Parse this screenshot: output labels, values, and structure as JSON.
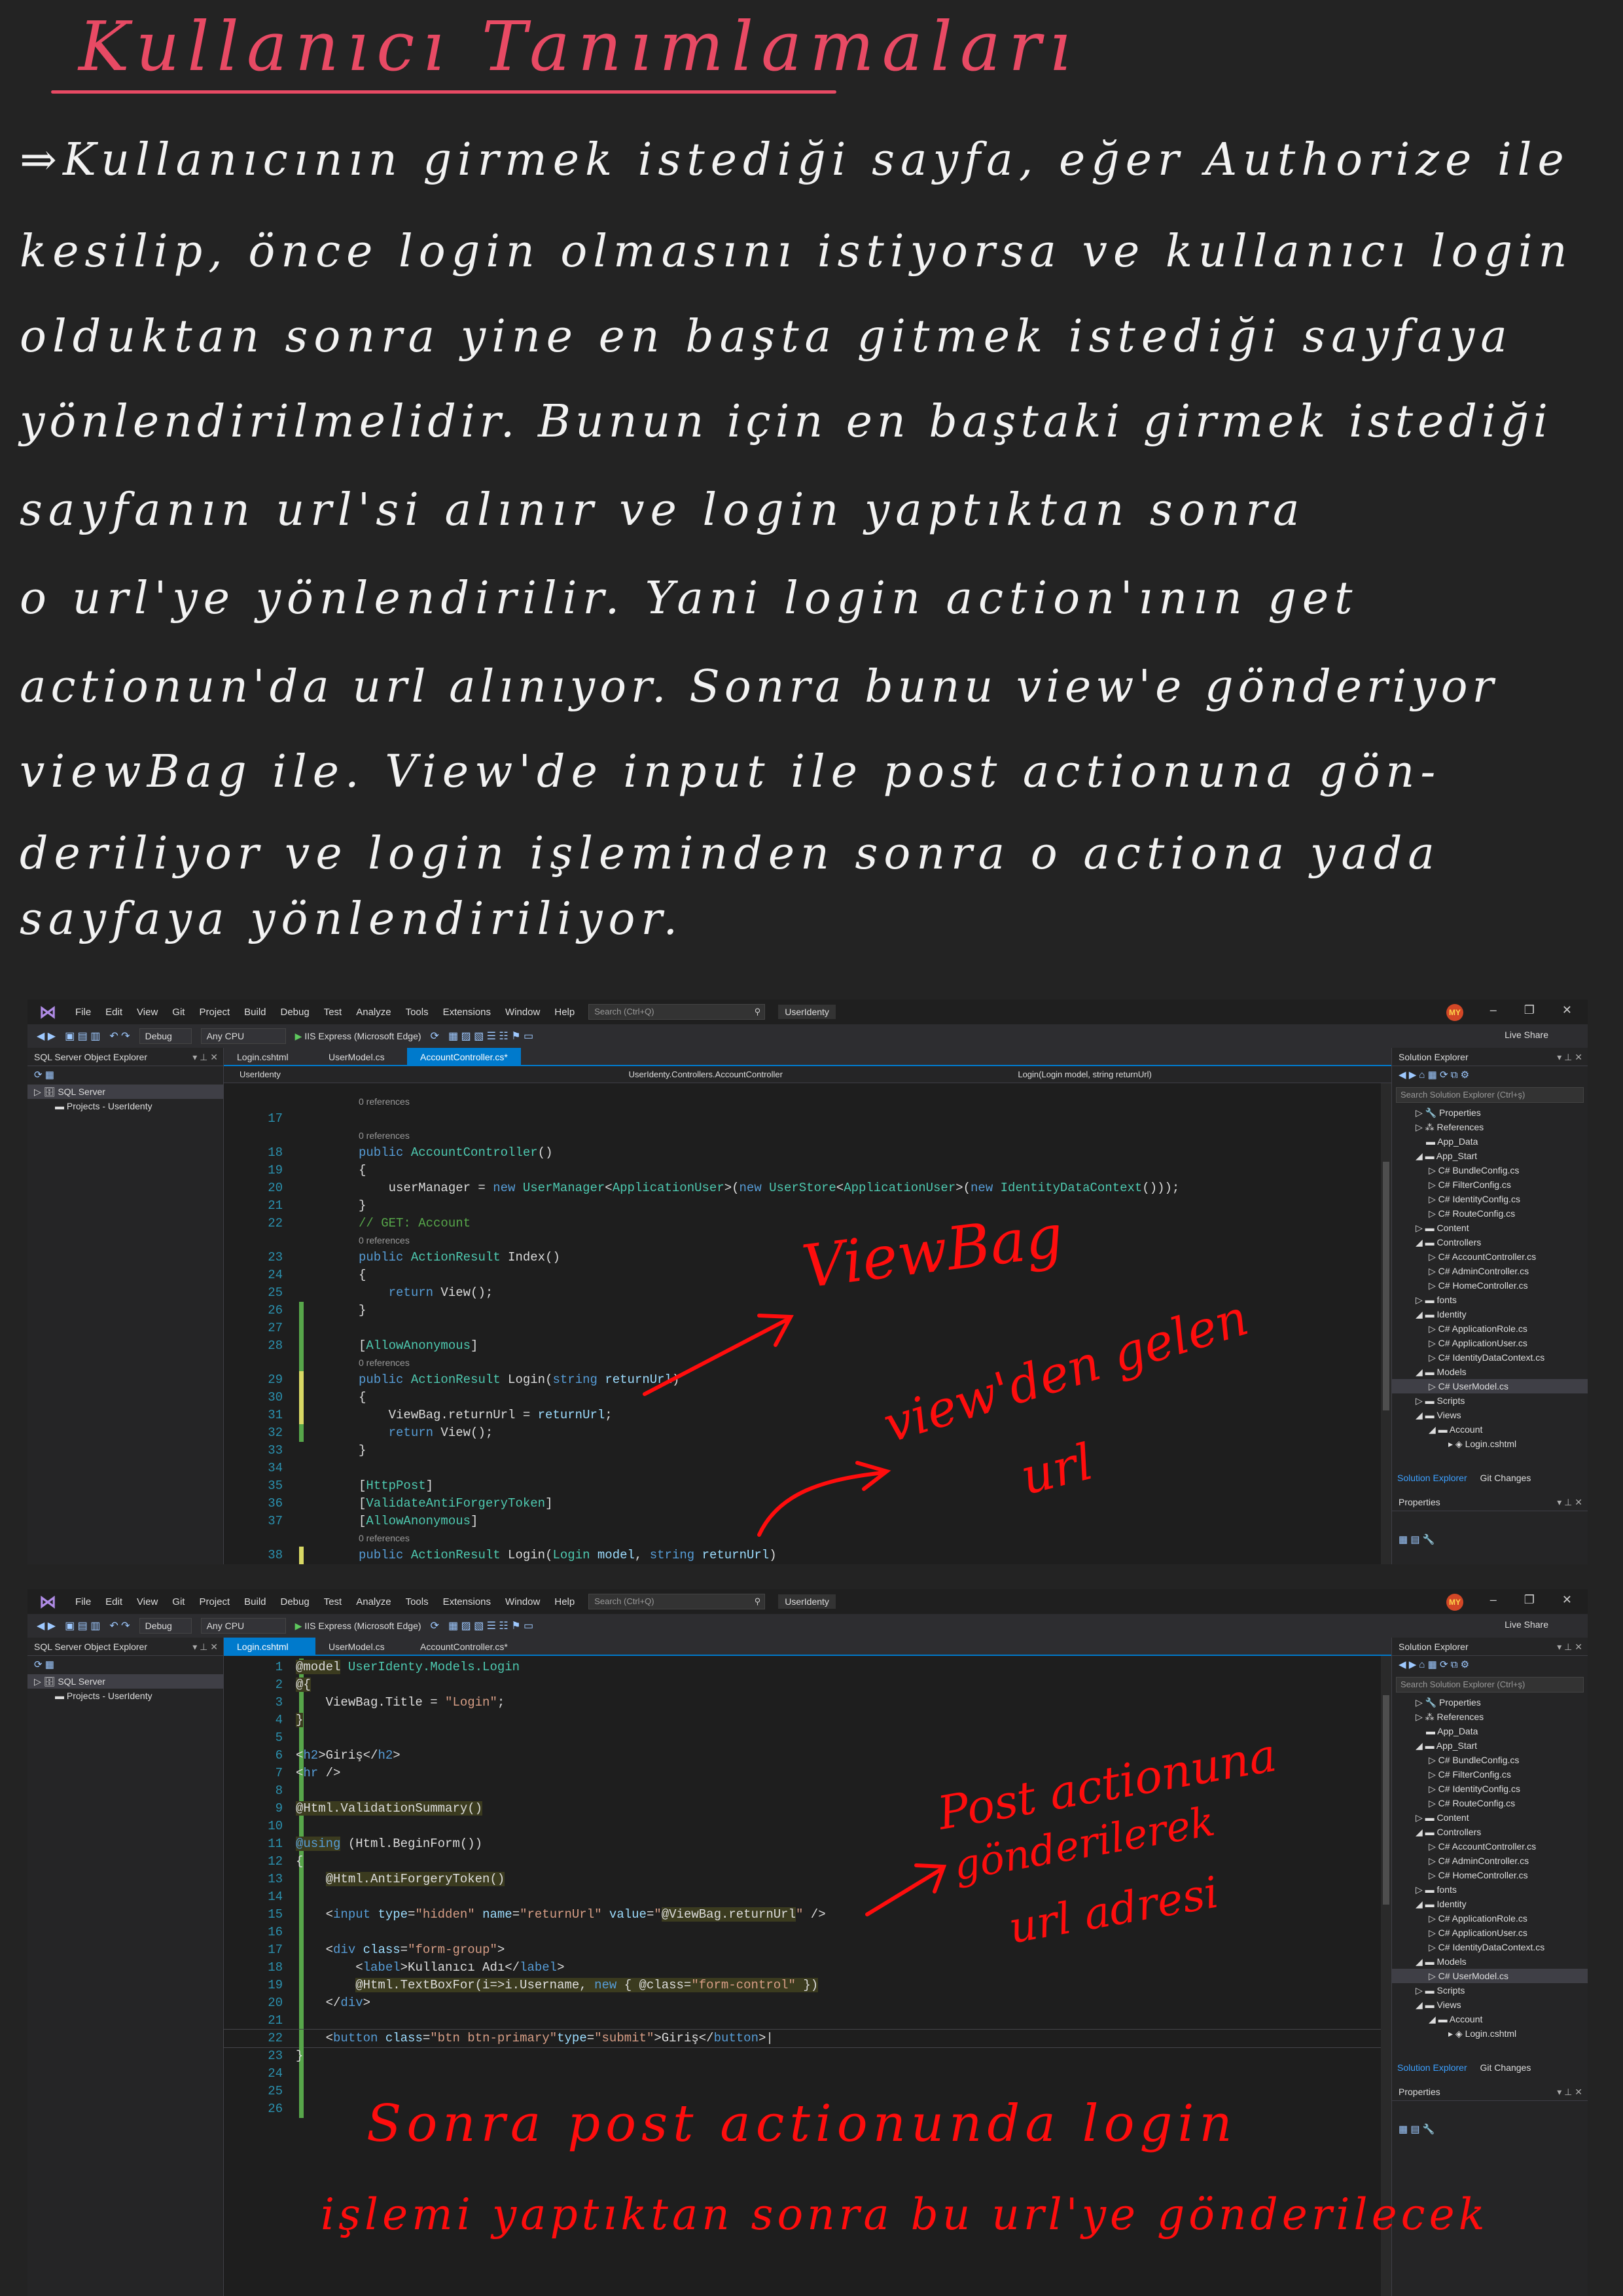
{
  "notes": {
    "title": "Kullanıcı Tanımlamaları",
    "lines": [
      "⇒Kullanıcının girmek istediği sayfa, eğer Authorize ile",
      "kesilip, önce login olmasını istiyorsa ve kullanıcı login",
      "olduktan sonra yine en başta gitmek istediği sayfaya",
      "yönlendirilmelidir. Bunun için en baştaki girmek istediği",
      "sayfanın url'si alınır ve login yaptıktan sonra",
      "o url'ye yönlendirilir. Yani login action'ının get",
      "actionun'da url alınıyor. Sonra bunu view'e gönderiyor",
      "viewBag ile. View'de input ile post actionuna gön-",
      "deriliyor ve login işleminden sonra o actiona yada",
      "sayfaya yönlendiriliyor."
    ]
  },
  "ide": {
    "menu": [
      "File",
      "Edit",
      "View",
      "Git",
      "Project",
      "Build",
      "Debug",
      "Test",
      "Analyze",
      "Tools",
      "Extensions",
      "Window",
      "Help"
    ],
    "search_placeholder": "Search (Ctrl+Q)",
    "project": "UserIdenty",
    "avatar": "MY",
    "config": "Debug",
    "platform": "Any CPU",
    "run_target": "IIS Express (Microsoft Edge)",
    "live_share": "Live Share",
    "left_panel_title": "SQL Server Object Explorer",
    "left_tree": [
      "SQL Server",
      "Projects - UserIdenty"
    ],
    "right_panel_title": "Solution Explorer",
    "right_search": "Search Solution Explorer (Ctrl+ş)",
    "solution_tree": [
      "Properties",
      "References",
      "App_Data",
      "App_Start",
      "BundleConfig.cs",
      "FilterConfig.cs",
      "IdentityConfig.cs",
      "RouteConfig.cs",
      "Content",
      "Controllers",
      "AccountController.cs",
      "AdminController.cs",
      "HomeController.cs",
      "fonts",
      "Identity",
      "ApplicationRole.cs",
      "ApplicationUser.cs",
      "IdentityDataContext.cs",
      "Models",
      "UserModel.cs",
      "Scripts",
      "Views",
      "Account",
      "Login.cshtml"
    ],
    "bottom_tabs": [
      "Solution Explorer",
      "Git Changes"
    ],
    "properties_title": "Properties",
    "references": "0 references"
  },
  "editor1": {
    "tabs": [
      "Login.cshtml",
      "UserModel.cs",
      "AccountController.cs*"
    ],
    "nav": [
      "UserIdenty",
      "UserIdenty.Controllers.AccountController",
      "Login(Login model, string returnUrl)"
    ]
  },
  "editor2": {
    "tabs": [
      "Login.cshtml",
      "UserModel.cs",
      "AccountController.cs*"
    ]
  },
  "annotations": {
    "viewbag": "ViewBag",
    "viewden_gelen": "view'den gelen",
    "url": "url",
    "post_actionuna": "Post actionuna",
    "gonderilerek": "gönderilerek",
    "url_adresi": "url adresi",
    "sonra_line1": "Sonra post actionunda login",
    "sonra_line2": "işlemi yaptıktan sonra bu url'ye gönderilecek"
  },
  "colors": {
    "annotation_red": "#ff0d0d",
    "title_pink": "#e84a64",
    "vs_accent": "#007acc"
  }
}
